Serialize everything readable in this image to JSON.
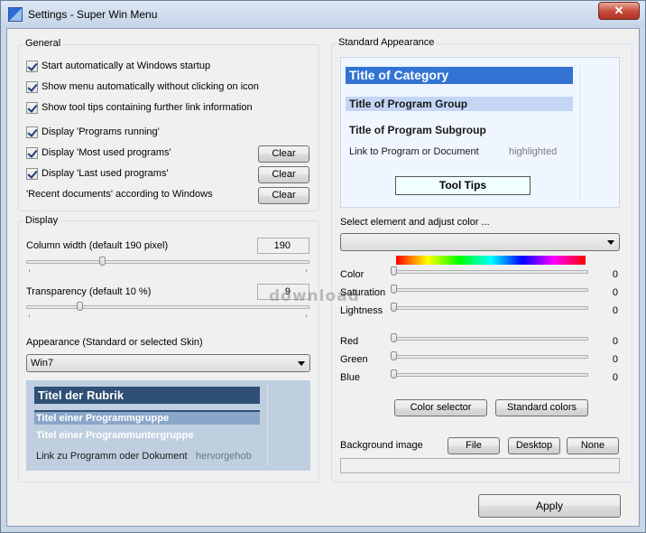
{
  "window": {
    "title": "Settings - Super Win Menu",
    "close_glyph": "✕"
  },
  "general": {
    "label": "General",
    "options": [
      {
        "label": "Start automatically at Windows startup",
        "checked": true
      },
      {
        "label": "Show menu automatically without clicking on icon",
        "checked": true
      },
      {
        "label": "Show tool tips containing further link information",
        "checked": true
      },
      {
        "label": "Display 'Programs running'",
        "checked": true
      },
      {
        "label": "Display 'Most used programs'",
        "checked": true
      },
      {
        "label": "Display 'Last used programs'",
        "checked": true
      }
    ],
    "recent_docs_label": "'Recent documents' according to Windows",
    "clear_label": "Clear"
  },
  "display": {
    "label": "Display",
    "column_width_label": "Column width  (default 190 pixel)",
    "column_width_value": "190",
    "column_width_level": 0.42,
    "transparency_label": "Transparency  (default 10 %)",
    "transparency_value": "9",
    "transparency_level": 0.2,
    "appearance_label": "Appearance (Standard or selected Skin)",
    "appearance_value": "Win7",
    "preview": {
      "category": "Titel der Rubrik",
      "group": "Titel einer Programmgruppe",
      "subgroup": "Titel einer Programmuntergruppe",
      "link": "Link zu Programm oder Dokument",
      "highlighted": "hervorgehob"
    }
  },
  "standard_appearance": {
    "label": "Standard Appearance",
    "preview": {
      "category": "Title of Category",
      "group": "Title of Program Group",
      "subgroup": "Title of Program Subgroup",
      "link": "Link to Program or Document",
      "highlighted": "highlighted",
      "tooltips": "Tool Tips"
    },
    "select_label": "Select element and adjust color ...",
    "select_value": "",
    "sliders": [
      {
        "label": "Color",
        "value": "0"
      },
      {
        "label": "Saturation",
        "value": "0"
      },
      {
        "label": "Lightness",
        "value": "0"
      },
      {
        "label": "Red",
        "value": "0"
      },
      {
        "label": "Green",
        "value": "0"
      },
      {
        "label": "Blue",
        "value": "0"
      }
    ],
    "color_selector_label": "Color selector",
    "standard_colors_label": "Standard colors",
    "background_image_label": "Background image",
    "file_label": "File",
    "desktop_label": "Desktop",
    "none_label": "None",
    "background_image_value": ""
  },
  "apply_label": "Apply",
  "watermark": "download",
  "colors": {
    "category_bar": "#3273d3",
    "group_bar": "#c4d6f4",
    "tooltip_bg": "#f0ffff",
    "skin_category": "#2f4f74",
    "skin_panel": "#bfcfe0"
  }
}
